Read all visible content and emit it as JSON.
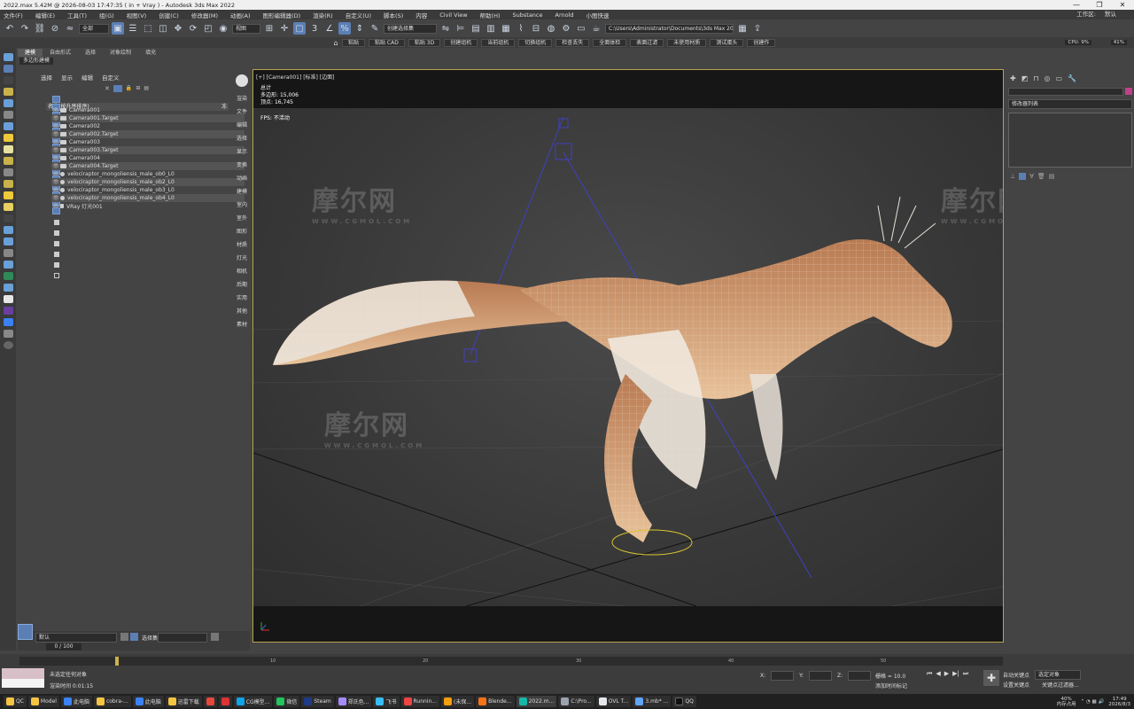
{
  "window": {
    "title": "2022.max  5.42M @ 2026-08-03 17:47:35  ( in + Vray ) - Autodesk 3ds Max 2022",
    "controls": [
      "—",
      "❐",
      "✕"
    ]
  },
  "menu": [
    "文件(F)",
    "编辑(E)",
    "工具(T)",
    "组(G)",
    "视图(V)",
    "创建(C)",
    "修改器(M)",
    "动画(A)",
    "图形编辑器(D)",
    "渲染(R)",
    "自定义(U)",
    "脚本(S)",
    "内容",
    "Civil View",
    "帮助(H)",
    "Substance",
    "Arnold",
    "小图快速"
  ],
  "workspace": {
    "label": "工作区:",
    "value": "默认"
  },
  "toolbar": {
    "selection_filter": "全部",
    "ref_coord": "视图",
    "named_set": "创建选择集",
    "path": "C:\\Users\\Administrator\\Documents\\3ds Max 2022"
  },
  "ribbon": [
    "粘贴",
    "粘贴 CAD",
    "粘贴 3D",
    "创建组机",
    "当前组机",
    "切换组机",
    "检查丢失",
    "全面体检",
    "表面过滤",
    "未使用材质",
    "测试蛋头",
    "创建作"
  ],
  "ribbon_status": {
    "cpu": "CPU: 9%",
    "mem": "41%"
  },
  "subtabs": [
    "建模",
    "自由形式",
    "选择",
    "对象绘制",
    "填充"
  ],
  "poly_label": "多边形建模",
  "scene_explorer": {
    "tabs": [
      "选择",
      "显示",
      "编辑",
      "自定义"
    ],
    "column_header": "名称(按升序排序)",
    "frozen_col": "冻",
    "items": [
      "Camera001",
      "Camera001.Target",
      "Camera002",
      "Camera002.Target",
      "Camera003",
      "Camera003.Target",
      "Camera004",
      "Camera004.Target",
      "velociraptor_mongoliensis_male_ob0_L0",
      "velociraptor_mongoliensis_male_ob2_L0",
      "velociraptor_mongoliensis_male_ob3_L0",
      "velociraptor_mongoliensis_male_ob4_L0",
      "VRay 灯光001"
    ]
  },
  "layer_bar": {
    "layer": "默认",
    "label": "选择集:"
  },
  "vtabs": [
    "渲染",
    "文件",
    "编辑",
    "选择",
    "显示",
    "变换",
    "动画",
    "建模",
    "室内",
    "室外",
    "图形",
    "材质",
    "灯光",
    "相机",
    "后期",
    "实用",
    "其他",
    "素材"
  ],
  "viewport": {
    "label": "[+] [Camera001] [标准] [边面]",
    "stats_title": "总计",
    "poly_label": "多边形:",
    "poly_value": "15,006",
    "vert_label": "顶点:",
    "vert_value": "16,745",
    "fps_label": "FPS:",
    "fps_value": "不活动"
  },
  "command_panel": {
    "list_label": "修改器列表"
  },
  "status": {
    "msg1": "未选定任何对象",
    "msg2": "渲染时间  0:01:15",
    "frame": "0 / 100",
    "grid": "栅格 = 10.0",
    "auto_key": "自动关键点",
    "set_key": "设置关键点",
    "sel": "选定对象",
    "key_filter": "关键点过滤器...",
    "add_time": "添加时间标记",
    "x_label": "X:",
    "y_label": "Y:",
    "z_label": "Z:"
  },
  "timeline_ticks": [
    "0",
    "10",
    "20",
    "30",
    "40",
    "50",
    "60",
    "70",
    "80",
    "90",
    "100"
  ],
  "taskbar": [
    {
      "label": "QC",
      "color": "#f5c542"
    },
    {
      "label": "Model",
      "color": "#f5c542"
    },
    {
      "label": "此电脑",
      "color": "#3b82f6"
    },
    {
      "label": "cobra-...",
      "color": "#f5c542"
    },
    {
      "label": "此电脑",
      "color": "#3b82f6"
    },
    {
      "label": "迅雷下载",
      "color": "#f5c542"
    },
    {
      "label": "",
      "color": "#e5483b"
    },
    {
      "label": "",
      "color": "#d33"
    },
    {
      "label": "CG模型...",
      "color": "#0ea5e9"
    },
    {
      "label": "微信",
      "color": "#22c55e"
    },
    {
      "label": "Steam",
      "color": "#1e3a8a"
    },
    {
      "label": "郑氏色...",
      "color": "#a78bfa"
    },
    {
      "label": "飞书",
      "color": "#38bdf8"
    },
    {
      "label": "Runnin...",
      "color": "#ef4444"
    },
    {
      "label": "(未保...",
      "color": "#f59e0b"
    },
    {
      "label": "Blende...",
      "color": "#f97316"
    },
    {
      "label": "2022.m...",
      "color": "#14b8a6"
    },
    {
      "label": "C:\\Pro...",
      "color": "#9ca3af"
    },
    {
      "label": "OVL T...",
      "color": "#e5e7eb"
    },
    {
      "label": "3.mb* ...",
      "color": "#60a5fa"
    },
    {
      "label": "QQ",
      "color": "#111"
    }
  ],
  "tray": {
    "pct": "40%",
    "mem": "内存占用",
    "time": "17:49",
    "date": "2026/8/3"
  },
  "watermark": {
    "cn": "摩尔网",
    "en": "WWW.CGMOL.COM"
  }
}
